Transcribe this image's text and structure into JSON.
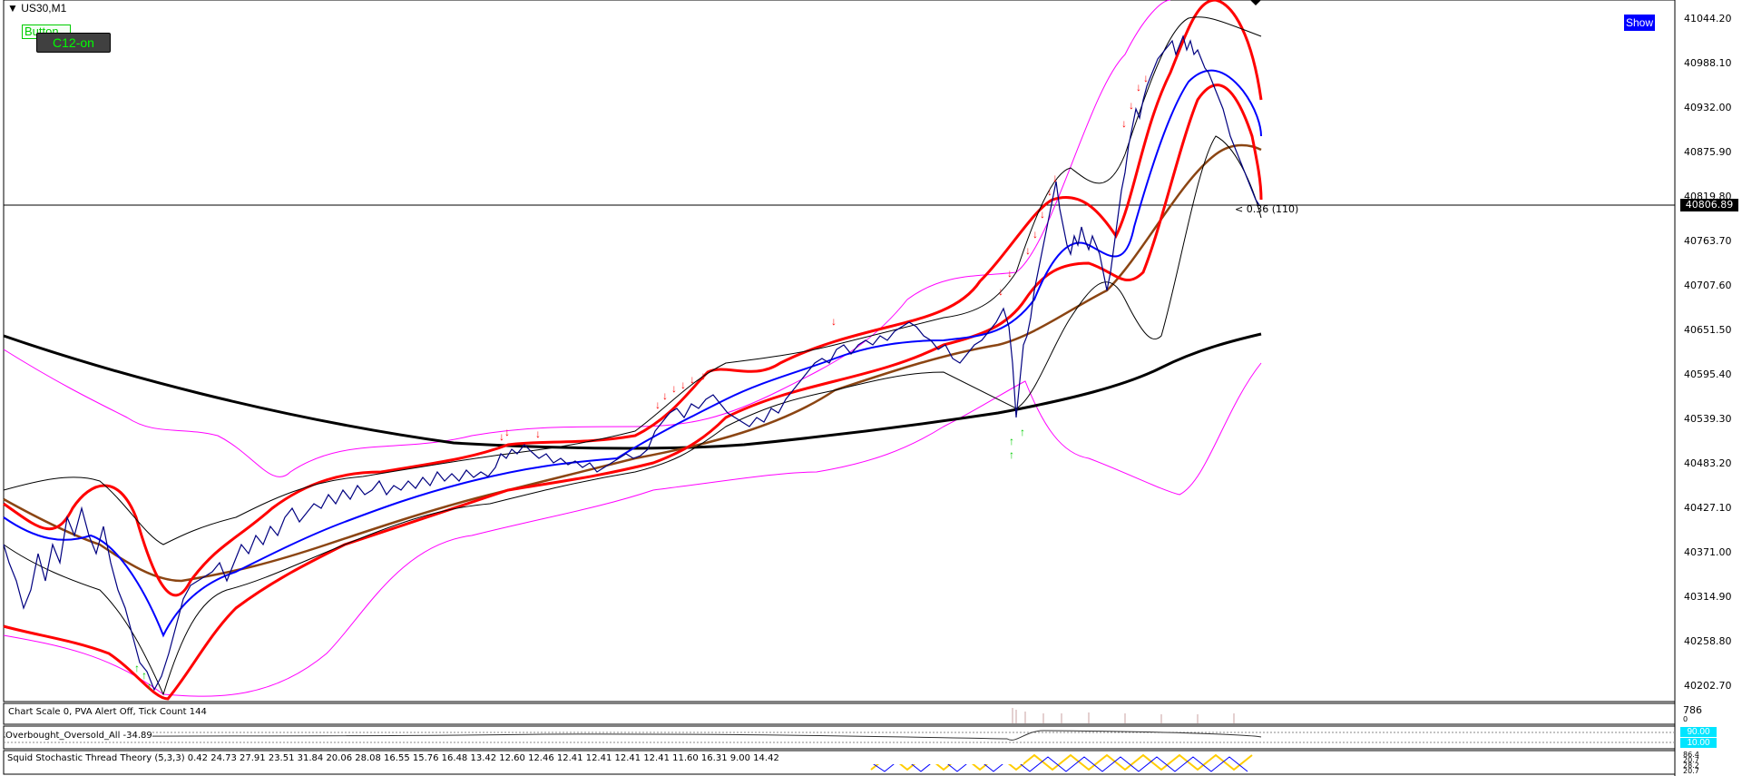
{
  "window": {
    "symbol_label": "US30,M1"
  },
  "buttons": {
    "show_label": "Show",
    "c12_label": "C12-on",
    "button_label": "Button"
  },
  "price_axis": {
    "ticks": [
      "41044.20",
      "40988.10",
      "40932.00",
      "40875.90",
      "40819.80",
      "40763.70",
      "40707.60",
      "40651.50",
      "40595.40",
      "40539.30",
      "40483.20",
      "40427.10",
      "40371.00",
      "40314.90",
      "40258.80",
      "40202.70"
    ],
    "current_price": "40806.89",
    "spread_label": "< 0.36 (110)"
  },
  "subwindows": {
    "volume_info": "Chart Scale  0,  PVA Alert Off,  Tick Count  144",
    "volume_scale_top": "786",
    "volume_scale_bottom": "0",
    "ob_os_label": "Overbought_Oversold_All -34.89",
    "ob_os_level_top": "90.00",
    "ob_os_level_bottom": "10.00",
    "stoch_label": "Squid Stochastic Thread Theory (5,3,3) 0.42 24.73 27.91 23.51 31.84 20.06 28.08 16.55 15.76 16.48 13.42 12.60 12.46 12.41 12.41 12.41 12.41 11.60 16.31 9.00 14.42",
    "stoch_scale": [
      "86.4",
      "20.7",
      "28.2",
      "20.7"
    ]
  },
  "colors": {
    "price_line": "#000080",
    "ma_red": "#ff0000",
    "ma_blue": "#0000ff",
    "ma_brown": "#8b4513",
    "ma_black": "#000000",
    "band_magenta": "#ff00ff",
    "arrow_up": "#00ff00",
    "arrow_down": "#ff0000",
    "stoch_yellow": "#ffcc00"
  }
}
